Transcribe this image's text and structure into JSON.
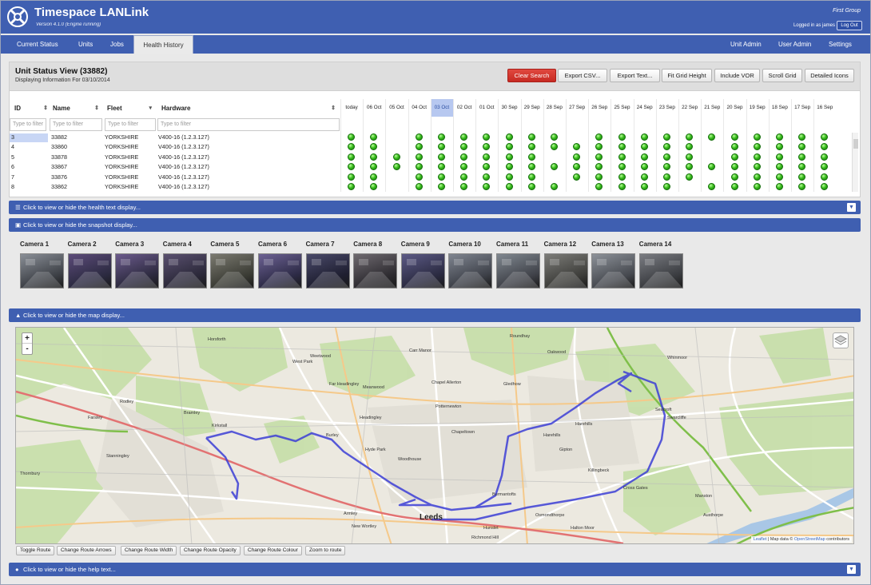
{
  "header": {
    "title": "Timespace LANLink",
    "version": "Version 4.1.0 (Engine running)",
    "organisation": "First Group",
    "logged_in": "Logged in as james",
    "logout_label": "Log Out",
    "color": "#3f5fb1"
  },
  "nav": {
    "left": [
      "Current Status",
      "Units",
      "Jobs",
      "Health History"
    ],
    "right": [
      "Unit Admin",
      "User Admin",
      "Settings"
    ],
    "active": "Health History"
  },
  "unit_view": {
    "title": "Unit Status View (33882)",
    "subtitle": "Displaying Information For 03/10/2014",
    "buttons": [
      "Clear Search",
      "Export CSV...",
      "Export Text...",
      "Fit Grid Height",
      "Include VOR",
      "Scroll Grid",
      "Detailed Icons"
    ]
  },
  "grid": {
    "columns": [
      "ID",
      "Name",
      "Fleet",
      "Hardware"
    ],
    "filter_placeholder": "Type to filter",
    "dates": [
      "today",
      "06 Oct",
      "05 Oct",
      "04 Oct",
      "03 Oct",
      "02 Oct",
      "01 Oct",
      "30 Sep",
      "29 Sep",
      "28 Sep",
      "27 Sep",
      "26 Sep",
      "25 Sep",
      "24 Sep",
      "23 Sep",
      "22 Sep",
      "21 Sep",
      "20 Sep",
      "19 Sep",
      "18 Sep",
      "17 Sep",
      "16 Sep"
    ],
    "highlight_date": "03 Oct",
    "rows": [
      {
        "id": "3",
        "name": "33882",
        "fleet": "YORKSHIRE",
        "hardware": "V400-16 (1.2.3.127)",
        "status": [
          1,
          1,
          0,
          1,
          1,
          1,
          1,
          1,
          1,
          1,
          0,
          1,
          1,
          1,
          1,
          1,
          1,
          1,
          1,
          1,
          1,
          1
        ]
      },
      {
        "id": "4",
        "name": "33860",
        "fleet": "YORKSHIRE",
        "hardware": "V400-16 (1.2.3.127)",
        "status": [
          1,
          1,
          0,
          1,
          1,
          1,
          1,
          1,
          1,
          1,
          1,
          1,
          1,
          1,
          1,
          1,
          0,
          1,
          1,
          1,
          1,
          1
        ]
      },
      {
        "id": "5",
        "name": "33878",
        "fleet": "YORKSHIRE",
        "hardware": "V400-16 (1.2.3.127)",
        "status": [
          1,
          1,
          1,
          1,
          1,
          1,
          1,
          1,
          1,
          0,
          1,
          1,
          1,
          1,
          1,
          1,
          0,
          1,
          1,
          1,
          1,
          1
        ]
      },
      {
        "id": "6",
        "name": "33867",
        "fleet": "YORKSHIRE",
        "hardware": "V400-16 (1.2.3.127)",
        "status": [
          1,
          1,
          1,
          1,
          1,
          1,
          1,
          1,
          1,
          1,
          1,
          1,
          1,
          1,
          1,
          1,
          1,
          1,
          1,
          1,
          1,
          1
        ]
      },
      {
        "id": "7",
        "name": "33876",
        "fleet": "YORKSHIRE",
        "hardware": "V400-16 (1.2.3.127)",
        "status": [
          1,
          1,
          0,
          1,
          1,
          1,
          1,
          1,
          1,
          0,
          1,
          1,
          1,
          1,
          1,
          1,
          0,
          1,
          1,
          1,
          1,
          1
        ]
      },
      {
        "id": "8",
        "name": "33862",
        "fleet": "YORKSHIRE",
        "hardware": "V400-16 (1.2.3.127)",
        "status": [
          1,
          1,
          0,
          1,
          1,
          1,
          1,
          1,
          1,
          1,
          0,
          1,
          1,
          1,
          1,
          0,
          1,
          1,
          1,
          1,
          1,
          1
        ]
      }
    ]
  },
  "sections": {
    "health_text": "Click to view or hide the health text display...",
    "snapshot": "Click to view or hide the snapshot display...",
    "map": "Click to view or hide the map display...",
    "help": "Click to view or hide the help text..."
  },
  "cameras": [
    "Camera 1",
    "Camera 2",
    "Camera 3",
    "Camera 4",
    "Camera 5",
    "Camera 6",
    "Camera 7",
    "Camera 8",
    "Camera 9",
    "Camera 10",
    "Camera 11",
    "Camera 12",
    "Camera 13",
    "Camera 14"
  ],
  "map": {
    "labels": [
      "Leeds",
      "Carr Manor",
      "Chapel Allerton",
      "Harehills",
      "Headingley",
      "Hyde Park",
      "Woodhouse",
      "Chapeltown",
      "Gipton",
      "Killingbeck",
      "Cross Gates",
      "Seacroft",
      "Swarcliffe",
      "Whinmoor",
      "Bramley",
      "Stanningley",
      "Rodley",
      "Armley",
      "New Wortley",
      "Hunslet",
      "Osmondthorpe",
      "Halton Moor",
      "Manston",
      "Austhorpe",
      "Weetwood",
      "Far Headingley",
      "Meanwood",
      "West Park",
      "Roundhay",
      "Oakwood",
      "Gledhow",
      "Burley",
      "Kirkstall",
      "Horsforth",
      "Farsley",
      "Thornbury",
      "Richmond Hill",
      "Burmantofts",
      "Potternewton",
      "Harehills"
    ],
    "zoom_in": "+",
    "zoom_out": "-",
    "attribution_leaflet": "Leaflet",
    "attribution_text": "| Map data ©",
    "attribution_osm": "OpenStreetMap",
    "attribution_end": "contributors",
    "buttons": [
      "Toggle Route",
      "Change Route Arrows",
      "Change Route Width",
      "Change Route Opacity",
      "Change Route Colour",
      "Zoom to route"
    ],
    "route_color": "#3d3fd6"
  }
}
